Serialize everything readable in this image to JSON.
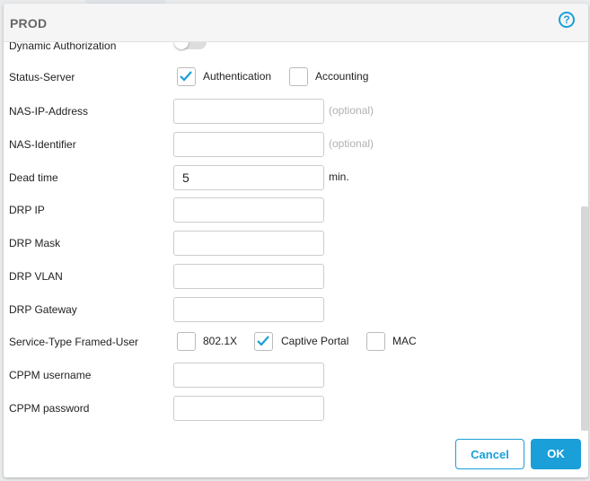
{
  "dialog": {
    "title": "PROD"
  },
  "form": {
    "dynamic_authorization": {
      "label": "Dynamic Authorization",
      "enabled": false
    },
    "status_server": {
      "label": "Status-Server",
      "options": [
        {
          "label": "Authentication",
          "checked": true
        },
        {
          "label": "Accounting",
          "checked": false
        }
      ]
    },
    "nas_ip": {
      "label": "NAS-IP-Address",
      "value": "",
      "hint": "(optional)"
    },
    "nas_identifier": {
      "label": "NAS-Identifier",
      "value": "",
      "hint": "(optional)"
    },
    "dead_time": {
      "label": "Dead time",
      "value": "5",
      "unit": "min."
    },
    "drp_ip": {
      "label": "DRP IP",
      "value": ""
    },
    "drp_mask": {
      "label": "DRP Mask",
      "value": ""
    },
    "drp_vlan": {
      "label": "DRP VLAN",
      "value": ""
    },
    "drp_gateway": {
      "label": "DRP Gateway",
      "value": ""
    },
    "service_type": {
      "label": "Service-Type Framed-User",
      "options": [
        {
          "label": "802.1X",
          "checked": false
        },
        {
          "label": "Captive Portal",
          "checked": true
        },
        {
          "label": "MAC",
          "checked": false
        }
      ]
    },
    "cppm_username": {
      "label": "CPPM username",
      "value": ""
    },
    "cppm_password": {
      "label": "CPPM password",
      "value": ""
    }
  },
  "footer": {
    "cancel_label": "Cancel",
    "ok_label": "OK"
  },
  "colors": {
    "accent": "#1a9fd8"
  },
  "icons": {
    "help": "help-circle-icon",
    "check": "checkmark-icon"
  }
}
